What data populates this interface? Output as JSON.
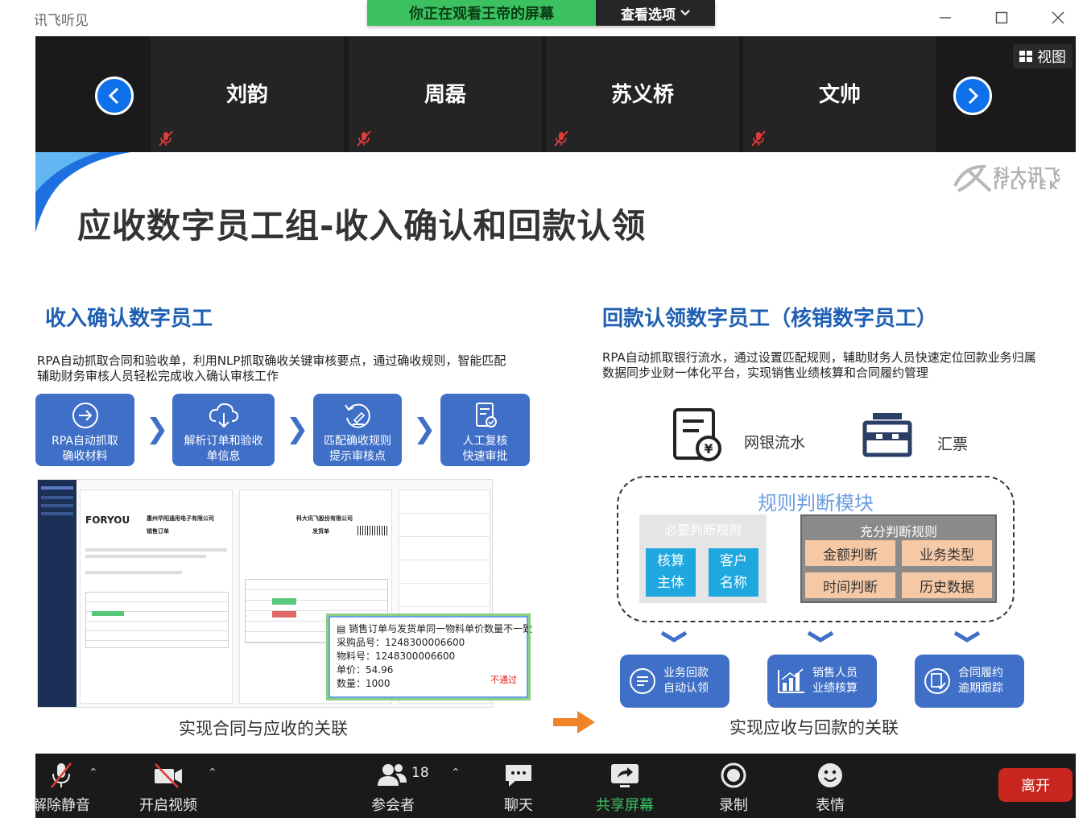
{
  "app": {
    "title": "讯飞听见"
  },
  "share_banner": {
    "status": "你正在观看王帝的屏幕",
    "options_label": "查看选项"
  },
  "participants": {
    "names": [
      "刘韵",
      "周磊",
      "苏义桥",
      "文帅"
    ],
    "view_label": "视图"
  },
  "slide": {
    "logo_cn": "科大讯飞",
    "logo_en": "iFLYTEK",
    "title": "应收数字员工组-收入确认和回款认领",
    "left": {
      "title": "收入确认数字员工",
      "desc_line1": "RPA自动抓取合同和验收单，利用NLP抓取确收关键审核要点，通过确收规则，智能匹配",
      "desc_line2": "辅助财务审核人员轻松完成收入确认审核工作",
      "steps": [
        {
          "line1": "RPA自动抓取",
          "line2": "确收材料",
          "icon": "arrow-circle-icon"
        },
        {
          "line1": "解析订单和验收",
          "line2": "单信息",
          "icon": "cloud-download-icon"
        },
        {
          "line1": "匹配确收规则",
          "line2": "提示审核点",
          "icon": "refresh-edit-icon"
        },
        {
          "line1": "人工复核",
          "line2": "快速审批",
          "icon": "document-check-icon"
        }
      ],
      "doc": {
        "brand": "FORYOU",
        "company_a": "惠州华阳通用电子有限公司",
        "order_title": "销售订单",
        "company_b": "科大讯飞股份有限公司",
        "shipping_title": "发货单"
      },
      "callout": {
        "headline": "销售订单与发货单同一物料单价数量不一致",
        "purchase_no": "采购品号：1248300006600",
        "material_no": "物料号：1248300006600",
        "unit_price": "单价：54.96",
        "quantity": "数量：1000",
        "result": "不通过"
      },
      "caption": "实现合同与应收的关联"
    },
    "right": {
      "title": "回款认领数字员工（核销数字员工）",
      "desc_line1": "RPA自动抓取银行流水，通过设置匹配规则，辅助财务人员快速定位回款业务归属",
      "desc_line2": "数据同步业财一体化平台，实现销售业绩核算和合同履约管理",
      "sources": [
        {
          "label": "网银流水",
          "icon": "bank-statement-icon"
        },
        {
          "label": "汇票",
          "icon": "bill-icon"
        }
      ],
      "rule_module": {
        "title": "规则判断模块",
        "required_title": "必要判断规则",
        "required_items": [
          {
            "line1": "核算",
            "line2": "主体"
          },
          {
            "line1": "客户",
            "line2": "名称"
          }
        ],
        "sufficient_title": "充分判断规则",
        "sufficient_items": [
          "金额判断",
          "业务类型",
          "时间判断",
          "历史数据"
        ]
      },
      "results": [
        {
          "line1": "业务回款",
          "line2": "自动认领",
          "icon": "money-cycle-icon"
        },
        {
          "line1": "销售人员",
          "line2": "业绩核算",
          "icon": "bar-chart-icon"
        },
        {
          "line1": "合同履约",
          "line2": "逾期跟踪",
          "icon": "contract-check-icon"
        }
      ],
      "caption": "实现应收与回款的关联"
    }
  },
  "toolbar": {
    "unmute": "解除静音",
    "start_video": "开启视频",
    "participants": "参会者",
    "participant_count": "18",
    "chat": "聊天",
    "share_screen": "共享屏幕",
    "record": "录制",
    "reactions": "表情",
    "leave": "离开"
  },
  "colors": {
    "share_green": "#3cc160",
    "zoom_blue": "#0e71eb",
    "slide_blue": "#3f6fc7",
    "title_blue": "#1e5fb3",
    "leave_red": "#c8261e"
  }
}
